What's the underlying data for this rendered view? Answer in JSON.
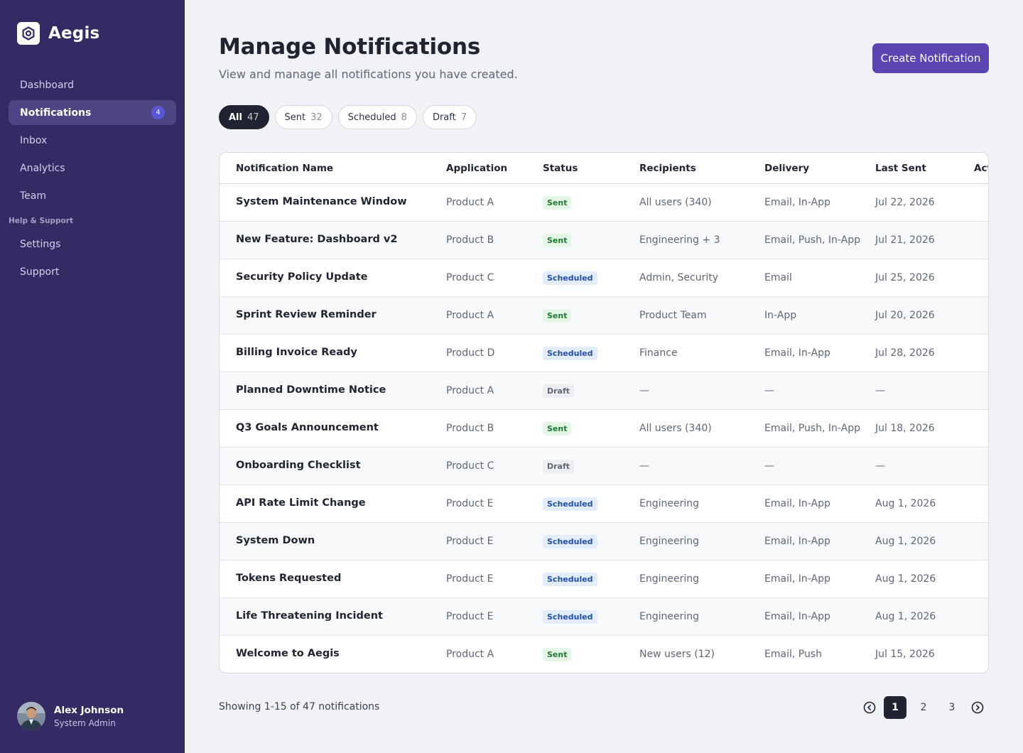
{
  "brand": {
    "name": "Aegis"
  },
  "nav": {
    "items": [
      {
        "label": "Dashboard"
      },
      {
        "label": "Notifications",
        "badge": "4"
      },
      {
        "label": "Inbox"
      },
      {
        "label": "Analytics"
      },
      {
        "label": "Team"
      }
    ],
    "section_label": "Help & Support",
    "support_items": [
      {
        "label": "Settings"
      },
      {
        "label": "Support"
      }
    ]
  },
  "user": {
    "name": "Alex Johnson",
    "role": "System Admin"
  },
  "header": {
    "title": "Manage Notifications",
    "subtitle": "View and manage all notifications you have created.",
    "create_label": "Create Notification"
  },
  "filters": [
    {
      "label": "All",
      "count": "47"
    },
    {
      "label": "Sent",
      "count": "32"
    },
    {
      "label": "Scheduled",
      "count": "8"
    },
    {
      "label": "Draft",
      "count": "7"
    }
  ],
  "table": {
    "columns": [
      "Notification Name",
      "Application",
      "Status",
      "Recipients",
      "Delivery",
      "Last Sent",
      "Actions"
    ],
    "rows": [
      {
        "name": "System Maintenance Window",
        "app": "Product A",
        "status": "Sent",
        "recipients": "All users (340)",
        "delivery": "Email, In-App",
        "last_sent": "Jul 22, 2026"
      },
      {
        "name": "New Feature: Dashboard v2",
        "app": "Product B",
        "status": "Sent",
        "recipients": "Engineering + 3",
        "delivery": "Email, Push, In-App",
        "last_sent": "Jul 21, 2026"
      },
      {
        "name": "Security Policy Update",
        "app": "Product C",
        "status": "Scheduled",
        "recipients": "Admin, Security",
        "delivery": "Email",
        "last_sent": "Jul 25, 2026"
      },
      {
        "name": "Sprint Review Reminder",
        "app": "Product A",
        "status": "Sent",
        "recipients": "Product Team",
        "delivery": "In-App",
        "last_sent": "Jul 20, 2026"
      },
      {
        "name": "Billing Invoice Ready",
        "app": "Product D",
        "status": "Scheduled",
        "recipients": "Finance",
        "delivery": "Email, In-App",
        "last_sent": "Jul 28, 2026"
      },
      {
        "name": "Planned Downtime Notice",
        "app": "Product A",
        "status": "Draft",
        "recipients": "—",
        "delivery": "—",
        "last_sent": "—"
      },
      {
        "name": "Q3 Goals Announcement",
        "app": "Product B",
        "status": "Sent",
        "recipients": "All users (340)",
        "delivery": "Email, Push, In-App",
        "last_sent": "Jul 18, 2026"
      },
      {
        "name": "Onboarding Checklist",
        "app": "Product C",
        "status": "Draft",
        "recipients": "—",
        "delivery": "—",
        "last_sent": "—"
      },
      {
        "name": "API Rate Limit Change",
        "app": "Product E",
        "status": "Scheduled",
        "recipients": "Engineering",
        "delivery": "Email, In-App",
        "last_sent": "Aug 1, 2026"
      },
      {
        "name": "System Down",
        "app": "Product E",
        "status": "Scheduled",
        "recipients": "Engineering",
        "delivery": "Email, In-App",
        "last_sent": "Aug 1, 2026"
      },
      {
        "name": "Tokens Requested",
        "app": "Product E",
        "status": "Scheduled",
        "recipients": "Engineering",
        "delivery": "Email, In-App",
        "last_sent": "Aug 1, 2026"
      },
      {
        "name": "Life Threatening Incident",
        "app": "Product E",
        "status": "Scheduled",
        "recipients": "Engineering",
        "delivery": "Email, In-App",
        "last_sent": "Aug 1, 2026"
      },
      {
        "name": "Welcome to Aegis",
        "app": "Product A",
        "status": "Sent",
        "recipients": "New users (12)",
        "delivery": "Email, Push",
        "last_sent": "Jul 15, 2026"
      }
    ]
  },
  "footer": {
    "showing": "Showing 1-15 of 47 notifications",
    "pages": [
      "1",
      "2",
      "3"
    ],
    "current_page": "1"
  },
  "colors": {
    "sidebar": "#352a63",
    "accent": "#5a45b3",
    "sent": "#1e7a34",
    "scheduled": "#2250a8",
    "draft": "#5f6775"
  }
}
